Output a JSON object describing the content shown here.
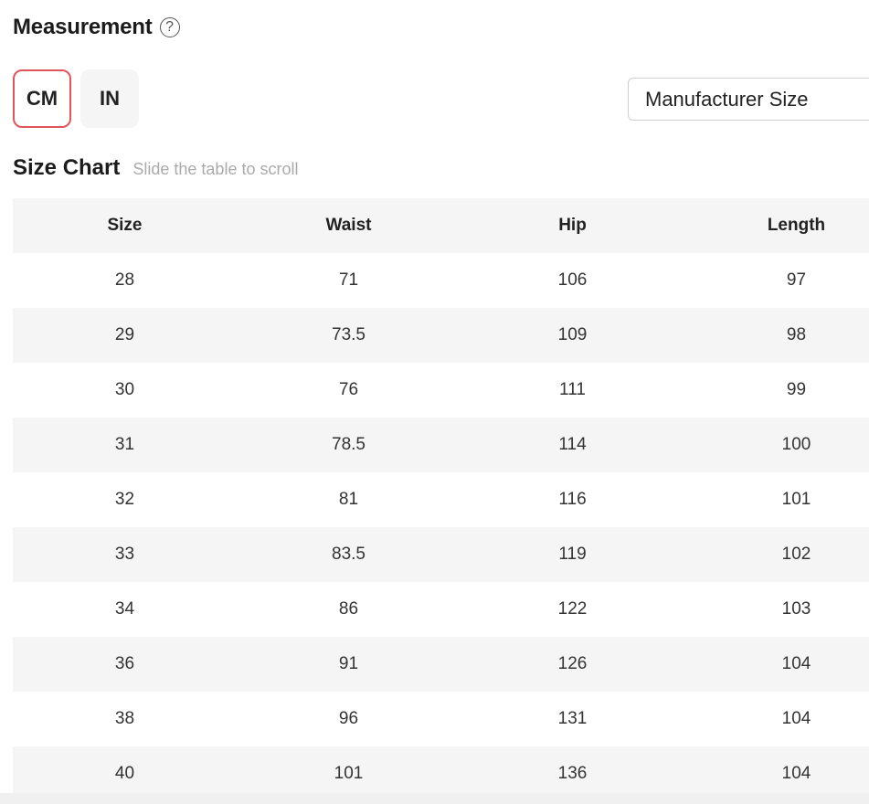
{
  "measurement": {
    "title": "Measurement",
    "help_icon": "question-circle-icon",
    "help_glyph": "?"
  },
  "units": {
    "cm_label": "CM",
    "in_label": "IN",
    "selected": "CM",
    "active_border_color": "#e0555a"
  },
  "size_select": {
    "value": "Manufacturer Size"
  },
  "size_chart": {
    "title": "Size Chart",
    "hint": "Slide the table to scroll",
    "headers": [
      "Size",
      "Waist",
      "Hip",
      "Length"
    ],
    "rows": [
      [
        "28",
        "71",
        "106",
        "97"
      ],
      [
        "29",
        "73.5",
        "109",
        "98"
      ],
      [
        "30",
        "76",
        "111",
        "99"
      ],
      [
        "31",
        "78.5",
        "114",
        "100"
      ],
      [
        "32",
        "81",
        "116",
        "101"
      ],
      [
        "33",
        "83.5",
        "119",
        "102"
      ],
      [
        "34",
        "86",
        "122",
        "103"
      ],
      [
        "36",
        "91",
        "126",
        "104"
      ],
      [
        "38",
        "96",
        "131",
        "104"
      ],
      [
        "40",
        "101",
        "136",
        "104"
      ]
    ]
  }
}
